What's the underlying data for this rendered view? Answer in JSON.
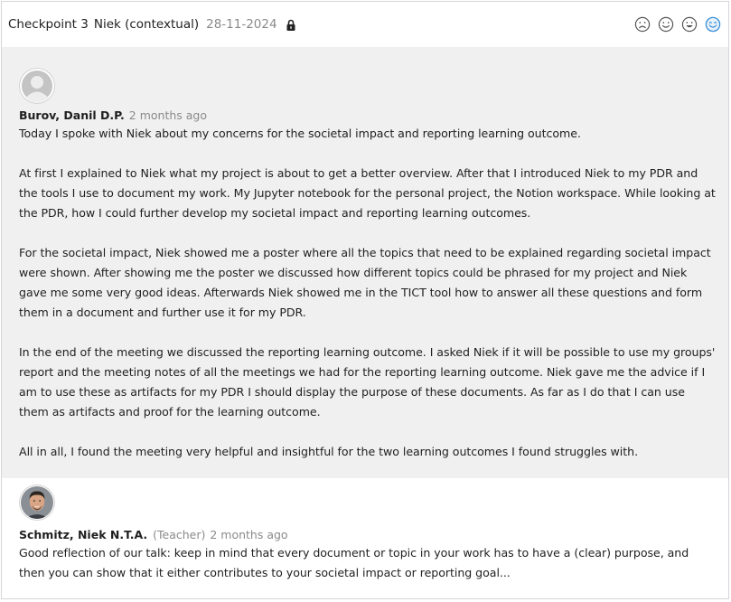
{
  "header": {
    "title": "Checkpoint 3",
    "assessor": "Niek (contextual)",
    "date": "28-11-2024",
    "lock_icon": "lock-icon",
    "moods": [
      {
        "name": "sad-face-icon",
        "color": "#555555"
      },
      {
        "name": "neutral-face-icon",
        "color": "#555555"
      },
      {
        "name": "happy-face-icon",
        "color": "#555555"
      },
      {
        "name": "very-happy-face-icon",
        "color": "#3b8fd6",
        "selected": true
      }
    ]
  },
  "comments": [
    {
      "author": "Burov, Danil D.P.",
      "role": "",
      "time": "2 months ago",
      "avatar": "default-avatar-icon",
      "paragraphs": [
        "Today I spoke with Niek about my concerns for the societal impact and reporting learning outcome.",
        "At first I explained to Niek what my project is about to get a better overview. After that I introduced Niek to my PDR and the tools I use to document my work. My Jupyter notebook for the personal project, the Notion workspace. While looking at the PDR, how I could further develop my societal impact and reporting learning outcomes.",
        "For the societal impact, Niek showed me a poster where all the topics that need to be explained regarding societal impact were shown. After showing me the poster we discussed how different topics could be phrased for my project and Niek gave me some very good ideas. Afterwards Niek showed me in the TICT tool how to answer all these questions and form them in a document and further use it for my PDR.",
        "In the end of the meeting we discussed the reporting learning outcome. I asked Niek if it will be possible to use my groups' report and the meeting notes of all the meetings we had for the reporting learning outcome. Niek gave me the advice if I am to use these as artifacts for my PDR I should display the purpose of these documents. As far as I do that I can use them as artifacts and proof for the learning outcome.",
        "All in all, I found the meeting very helpful and insightful for the two learning outcomes I found struggles with."
      ]
    },
    {
      "author": "Schmitz, Niek N.T.A.",
      "role": "(Teacher)",
      "time": "2 months ago",
      "avatar": "teacher-photo-avatar",
      "paragraphs": [
        "Good reflection of our talk: keep in mind that every document or topic in your work has to have a (clear) purpose, and then you can show that it either contributes to your societal impact or reporting goal..."
      ]
    }
  ]
}
